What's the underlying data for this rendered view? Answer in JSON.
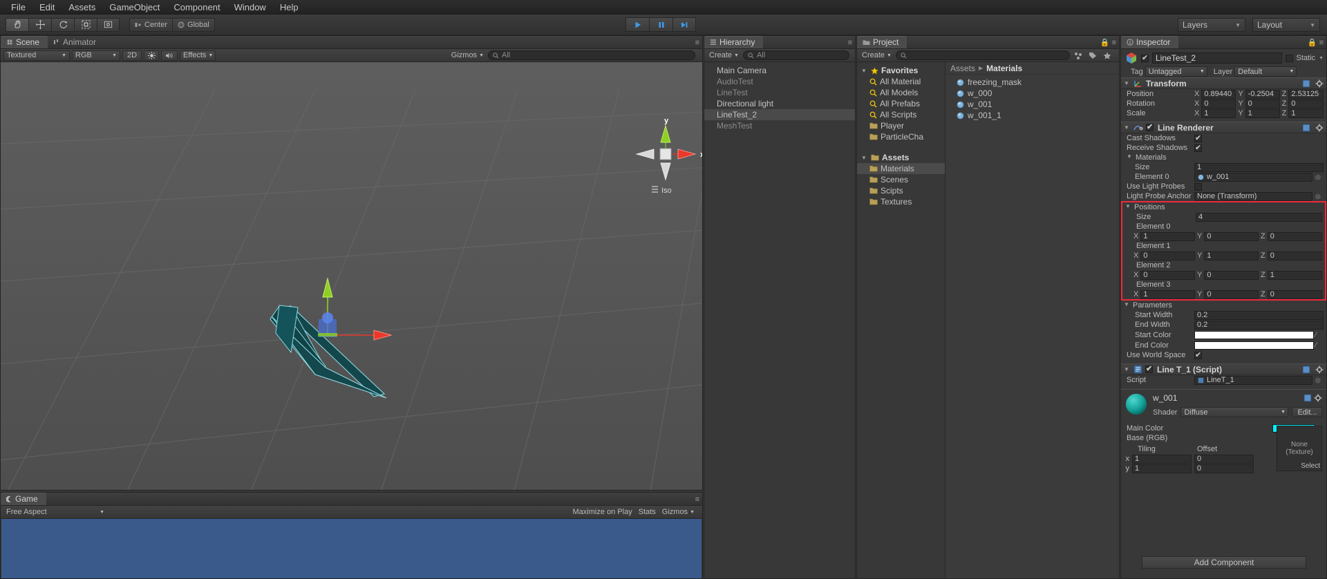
{
  "menubar": {
    "items": [
      "File",
      "Edit",
      "Assets",
      "GameObject",
      "Component",
      "Window",
      "Help"
    ]
  },
  "toolbar": {
    "tools": [
      "hand-tool",
      "move-tool",
      "rotate-tool",
      "scale-tool",
      "rect-tool"
    ],
    "pivot_label": "Center",
    "space_label": "Global",
    "play_label": "play-button",
    "pause_label": "pause-button",
    "step_label": "step-button",
    "layers_label": "Layers",
    "layout_label": "Layout"
  },
  "scene": {
    "tabs": [
      {
        "label": "Scene",
        "icon": "scene-icon",
        "active": true
      },
      {
        "label": "Animator",
        "icon": "animator-icon",
        "active": false
      }
    ],
    "draw_mode": "Textured",
    "color_mode": "RGB",
    "two_d": "2D",
    "lighting": "light-icon",
    "audio": "audio-icon",
    "effects": "Effects",
    "gizmos_label": "Gizmos",
    "search_placeholder": "All",
    "search_value": "All",
    "axis_x": "x",
    "axis_y": "y",
    "projection": "Iso"
  },
  "game": {
    "tab_label": "Game",
    "aspect": "Free Aspect",
    "maximize": "Maximize on Play",
    "stats": "Stats",
    "gizmos": "Gizmos"
  },
  "hierarchy": {
    "tab_label": "Hierarchy",
    "create_label": "Create",
    "search_value": "All",
    "items": [
      {
        "label": "Main Camera",
        "dim": false,
        "selected": false
      },
      {
        "label": "AudioTest",
        "dim": true,
        "selected": false
      },
      {
        "label": "LineTest",
        "dim": true,
        "selected": false
      },
      {
        "label": "Directional light",
        "dim": false,
        "selected": false
      },
      {
        "label": "LineTest_2",
        "dim": false,
        "selected": true
      },
      {
        "label": "MeshTest",
        "dim": true,
        "selected": false
      }
    ]
  },
  "project": {
    "tab_label": "Project",
    "create_label": "Create",
    "search_value": "",
    "favorites_label": "Favorites",
    "favorites": [
      {
        "label": "All Material",
        "icon": "search-icon"
      },
      {
        "label": "All Models",
        "icon": "search-icon"
      },
      {
        "label": "All Prefabs",
        "icon": "search-icon"
      },
      {
        "label": "All Scripts",
        "icon": "search-icon"
      },
      {
        "label": "Player",
        "icon": "folder-icon"
      },
      {
        "label": "ParticleCha",
        "icon": "folder-icon"
      }
    ],
    "assets_label": "Assets",
    "folders": [
      {
        "label": "Materials",
        "selected": true
      },
      {
        "label": "Scenes",
        "selected": false
      },
      {
        "label": "Scipts",
        "selected": false
      },
      {
        "label": "Textures",
        "selected": false
      }
    ],
    "breadcrumb": [
      "Assets",
      "Materials"
    ],
    "assets": [
      {
        "label": "freezing_mask",
        "icon": "material-icon"
      },
      {
        "label": "w_000",
        "icon": "material-icon"
      },
      {
        "label": "w_001",
        "icon": "material-icon"
      },
      {
        "label": "w_001_1",
        "icon": "material-icon"
      }
    ]
  },
  "inspector": {
    "tab_label": "Inspector",
    "object_name": "LineTest_2",
    "object_enabled": true,
    "static_label": "Static",
    "tag_label": "Tag",
    "tag_value": "Untagged",
    "layer_label": "Layer",
    "layer_value": "Default",
    "transform": {
      "title": "Transform",
      "rows": [
        {
          "label": "Position",
          "x": "0.89440",
          "y": "-0.2504",
          "z": "2.53125"
        },
        {
          "label": "Rotation",
          "x": "0",
          "y": "0",
          "z": "0"
        },
        {
          "label": "Scale",
          "x": "1",
          "y": "1",
          "z": "1"
        }
      ]
    },
    "line_renderer": {
      "title": "Line Renderer",
      "enabled": true,
      "cast_shadows_label": "Cast Shadows",
      "cast_shadows": true,
      "receive_shadows_label": "Receive Shadows",
      "receive_shadows": true,
      "materials_label": "Materials",
      "materials_size_label": "Size",
      "materials_size": "1",
      "element0_label": "Element 0",
      "element0_value": "w_001",
      "use_light_probes_label": "Use Light Probes",
      "use_light_probes": false,
      "light_probe_anchor_label": "Light Probe Anchor",
      "light_probe_anchor_value": "None (Transform)",
      "positions_label": "Positions",
      "positions_size_label": "Size",
      "positions_size": "4",
      "positions": [
        {
          "label": "Element 0",
          "x": "1",
          "y": "0",
          "z": "0"
        },
        {
          "label": "Element 1",
          "x": "0",
          "y": "1",
          "z": "0"
        },
        {
          "label": "Element 2",
          "x": "0",
          "y": "0",
          "z": "1"
        },
        {
          "label": "Element 3",
          "x": "1",
          "y": "0",
          "z": "0"
        }
      ],
      "parameters_label": "Parameters",
      "start_width_label": "Start Width",
      "start_width": "0.2",
      "end_width_label": "End Width",
      "end_width": "0.2",
      "start_color_label": "Start Color",
      "start_color": "#ffffff",
      "end_color_label": "End Color",
      "end_color": "#ffffff",
      "use_world_space_label": "Use World Space",
      "use_world_space": true
    },
    "script_component": {
      "title": "Line T_1 (Script)",
      "enabled": true,
      "script_label": "Script",
      "script_value": "LineT_1"
    },
    "material": {
      "name": "w_001",
      "shader_label": "Shader",
      "shader_value": "Diffuse",
      "edit_label": "Edit...",
      "main_color_label": "Main Color",
      "main_color": "#00f0ff",
      "base_rgb_label": "Base (RGB)",
      "tiling_label": "Tiling",
      "offset_label": "Offset",
      "x_label": "x",
      "y_label": "y",
      "tiling_x": "1",
      "offset_x": "0",
      "tiling_y": "1",
      "offset_y": "0",
      "texture_none": "None",
      "texture_type": "(Texture)",
      "select_label": "Select"
    },
    "add_component_label": "Add Component"
  },
  "colors": {
    "highlight_red": "#ee2b3c",
    "play_blue": "#3d9be9",
    "material_cyan": "#00f0ff",
    "line_teal": "#13474b",
    "line_edge": "#8fd8e0",
    "axis_x": "#e8392b",
    "axis_y": "#8ed021"
  }
}
